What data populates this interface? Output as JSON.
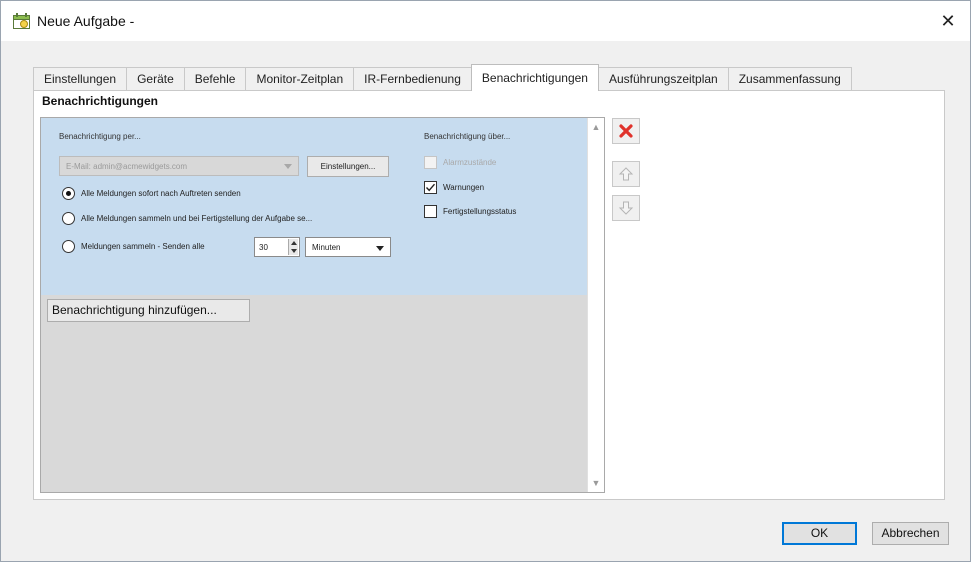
{
  "window": {
    "title": "Neue Aufgabe -",
    "close_glyph": "✕"
  },
  "tabs": [
    {
      "label": "Einstellungen",
      "active": false
    },
    {
      "label": "Geräte",
      "active": false
    },
    {
      "label": "Befehle",
      "active": false
    },
    {
      "label": "Monitor-Zeitplan",
      "active": false
    },
    {
      "label": "IR-Fernbedienung",
      "active": false
    },
    {
      "label": "Benachrichtigungen",
      "active": true
    },
    {
      "label": "Ausführungszeitplan",
      "active": false
    },
    {
      "label": "Zusammenfassung",
      "active": false
    }
  ],
  "panel": {
    "section_title": "Benachrichtigungen",
    "notify_via_label": "Benachrichtigung per...",
    "email_value": "E-Mail: admin@acmewidgets.com",
    "settings_button": "Einstellungen...",
    "radio_options": [
      {
        "label": "Alle Meldungen sofort nach Auftreten senden",
        "selected": true
      },
      {
        "label": "Alle Meldungen sammeln und bei Fertigstellung der Aufgabe se...",
        "selected": false
      },
      {
        "label": "Meldungen sammeln - Senden alle",
        "selected": false
      }
    ],
    "interval_value": "30",
    "interval_unit": "Minuten",
    "notify_about_label": "Benachrichtigung über...",
    "checkboxes": [
      {
        "label": "Alarmzustände",
        "checked": false,
        "disabled": true
      },
      {
        "label": "Warnungen",
        "checked": true,
        "disabled": false
      },
      {
        "label": "Fertigstellungsstatus",
        "checked": false,
        "disabled": false
      }
    ],
    "add_button": "Benachrichtigung hinzufügen..."
  },
  "icons": {
    "delete": "delete-icon",
    "up": "arrow-up-icon",
    "down": "arrow-down-icon"
  },
  "colors": {
    "delete_red": "#e0322b",
    "item_blue": "#c7dcef",
    "list_gray": "#d9d9d9",
    "default_button_border": "#0078d7"
  },
  "buttons": {
    "ok": "OK",
    "cancel": "Abbrechen"
  }
}
